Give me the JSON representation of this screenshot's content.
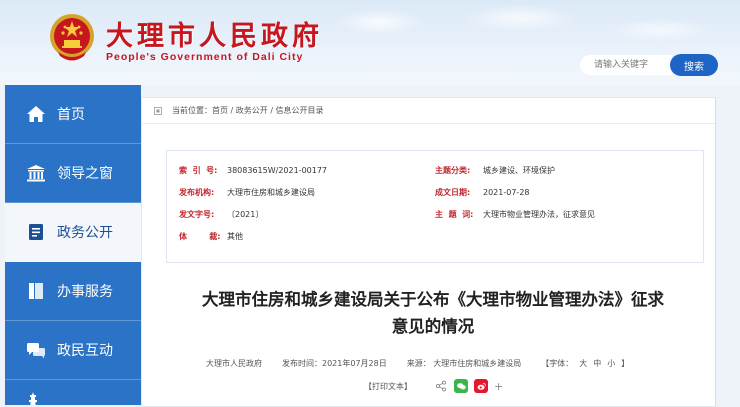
{
  "header": {
    "title": "大理市人民政府",
    "subtitle": "People's Government of Dali City",
    "search_placeholder": "请输入关键字",
    "search_button": "搜索"
  },
  "sidebar": {
    "items": [
      {
        "label": "首页",
        "icon": "home-icon"
      },
      {
        "label": "领导之窗",
        "icon": "government-building-icon"
      },
      {
        "label": "政务公开",
        "icon": "document-icon"
      },
      {
        "label": "办事服务",
        "icon": "book-icon"
      },
      {
        "label": "政民互动",
        "icon": "chat-bubbles-icon"
      }
    ],
    "active_index": 2
  },
  "breadcrumb": {
    "prefix": "当前位置：",
    "path": "首页 / 政务公开 / 信息公开目录"
  },
  "info": {
    "index_label": "索  引  号:",
    "index_value": "38083615W/2021-00177",
    "topic_label": "主题分类:",
    "topic_value": "城乡建设、环境保护",
    "issuer_label": "发布机构:",
    "issuer_value": "大理市住房和城乡建设局",
    "date_label": "成文日期:",
    "date_value": "2021-07-28",
    "docno_label": "发文字号:",
    "docno_value": "〔2021〕",
    "subject_label": "主  题  词:",
    "subject_value": "大理市物业管理办法，征求意见",
    "carrier_label": "体        裁:",
    "carrier_value": "其他"
  },
  "article": {
    "title": "大理市住房和城乡建设局关于公布《大理市物业管理办法》征求意见的情况",
    "author": "大理市人民政府",
    "publish_time": "发布时间：2021年07月28日",
    "source": "来源： 大理市住房和城乡建设局",
    "font_label_open": "【字体：",
    "font_large": "大",
    "font_medium": "中",
    "font_small": "小",
    "font_label_close": "】",
    "print": "【打印文本】",
    "share_more": "+"
  },
  "colors": {
    "brand_red": "#c7161e",
    "nav_blue": "#2a73c6",
    "button_blue": "#1e64c4",
    "label_red": "#c0282e",
    "wechat_green": "#3bb54a",
    "weibo_red": "#e6162d"
  }
}
